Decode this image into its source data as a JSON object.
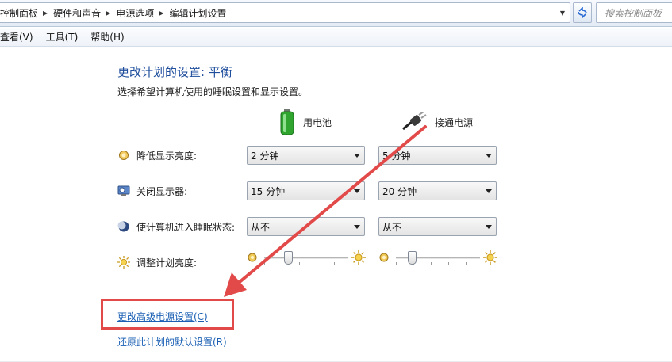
{
  "address_bar": {
    "breadcrumbs": [
      "控制面板",
      "硬件和声音",
      "电源选项",
      "编辑计划设置"
    ],
    "search_placeholder": "搜索控制面板"
  },
  "menu": {
    "items": [
      "查看(V)",
      "工具(T)",
      "帮助(H)"
    ]
  },
  "page": {
    "title": "更改计划的设置: 平衡",
    "description": "选择希望计算机使用的睡眠设置和显示设置。"
  },
  "columns": {
    "battery": "用电池",
    "plugged_in": "接通电源"
  },
  "settings": [
    {
      "label": "降低显示亮度:",
      "icon": "dim-display-icon",
      "battery": "2 分钟",
      "plugged_in": "5 分钟"
    },
    {
      "label": "关闭显示器:",
      "icon": "monitor-icon",
      "battery": "15 分钟",
      "plugged_in": "20 分钟"
    },
    {
      "label": "使计算机进入睡眠状态:",
      "icon": "sleep-moon-icon",
      "battery": "从不",
      "plugged_in": "从不"
    }
  ],
  "brightness": {
    "label": "调整计划亮度:",
    "battery_level": 0.28,
    "plugged_in_level": 0.19
  },
  "links": {
    "advanced": "更改高级电源设置(C)",
    "restore": "还原此计划的默认设置(R)"
  },
  "colors": {
    "accent": "#1f4e9c",
    "link": "#1a5fb4",
    "annotation": "#e24a4a"
  }
}
